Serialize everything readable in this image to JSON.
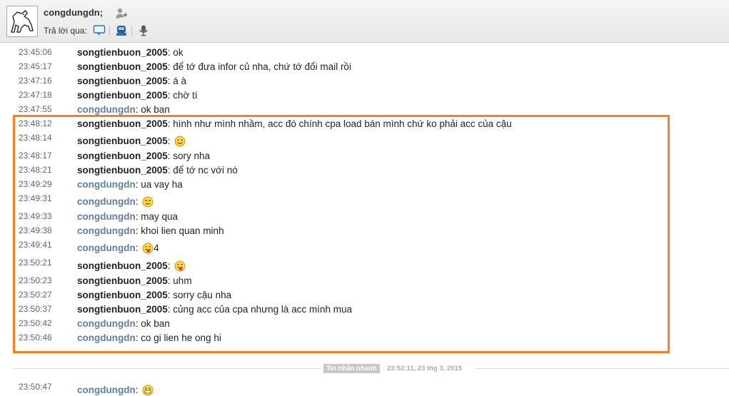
{
  "header": {
    "contact_name": "congdungdn;",
    "reply_label": "Trả lời qua:",
    "icons": [
      "avatar-horse",
      "add-contact-icon",
      "chat-bubble-icon",
      "sms-phone-icon",
      "microphone-icon"
    ]
  },
  "messages": [
    {
      "time": "23:45:06",
      "sender": "songtienbuon_2005",
      "text": "ok"
    },
    {
      "time": "23:45:17",
      "sender": "songtienbuon_2005",
      "text": "để tớ đưa infor củ nha, chứ tớ đổi mail rồi"
    },
    {
      "time": "23:47:16",
      "sender": "songtienbuon_2005",
      "text": "á à"
    },
    {
      "time": "23:47:18",
      "sender": "songtienbuon_2005",
      "text": "chờ tí"
    },
    {
      "time": "23:47:55",
      "sender": "congdungdn",
      "text": "ok ban"
    },
    {
      "time": "23:48:12",
      "sender": "songtienbuon_2005",
      "text": "hình như mình nhầm, acc đó chính cpa load bán mình chứ ko phải acc của cậu"
    },
    {
      "time": "23:48:14",
      "sender": "songtienbuon_2005",
      "text": "",
      "emoji": "smile"
    },
    {
      "time": "23:48:17",
      "sender": "songtienbuon_2005",
      "text": "sory nha"
    },
    {
      "time": "23:48:21",
      "sender": "songtienbuon_2005",
      "text": "để tớ nc với nó"
    },
    {
      "time": "23:49:29",
      "sender": "congdungdn",
      "text": "ua vay ha"
    },
    {
      "time": "23:49:31",
      "sender": "congdungdn",
      "text": "",
      "emoji": "straight-face"
    },
    {
      "time": "23:49:33",
      "sender": "congdungdn",
      "text": "may qua"
    },
    {
      "time": "23:49:38",
      "sender": "congdungdn",
      "text": "khoi lien quan minh"
    },
    {
      "time": "23:49:41",
      "sender": "congdungdn",
      "text": "4",
      "emoji": "tongue"
    },
    {
      "time": "23:50:21",
      "sender": "songtienbuon_2005",
      "text": "",
      "emoji": "tongue"
    },
    {
      "time": "23:50:23",
      "sender": "songtienbuon_2005",
      "text": "uhm"
    },
    {
      "time": "23:50:27",
      "sender": "songtienbuon_2005",
      "text": "sorry cậu nha"
    },
    {
      "time": "23:50:37",
      "sender": "songtienbuon_2005",
      "text": "củng acc của cpa nhưng là acc mình mua"
    },
    {
      "time": "23:50:42",
      "sender": "congdungdn",
      "text": "ok ban"
    },
    {
      "time": "23:50:46",
      "sender": "congdungdn",
      "text": "co gi lien he ong hi"
    }
  ],
  "divider": {
    "tag": "Tin nhắn nhanh",
    "timestamp": "23:52:11, 23 thg 3, 2015"
  },
  "partial_message": {
    "time": "23:50:47",
    "sender": "congdungdn",
    "emoji": "grin"
  },
  "colors": {
    "highlight_border": "#f58025",
    "self_sender": "#5f7f9f",
    "peer_sender": "#222222"
  }
}
